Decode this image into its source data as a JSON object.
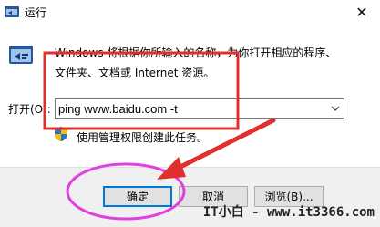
{
  "window": {
    "title": "运行",
    "close_glyph": "✕"
  },
  "description": {
    "line1": "Windows 将根据你所输入的名称，为你打开相应的程序、",
    "line2": "文件夹、文档或 Internet 资源。"
  },
  "open_field": {
    "label": "打开(O):",
    "value": "ping www.baidu.com -t"
  },
  "admin_note": "使用管理权限创建此任务。",
  "buttons": {
    "ok": "确定",
    "cancel": "取消",
    "browse": "浏览(B)..."
  },
  "watermark": "IT小白 - www.it3366.com",
  "colors": {
    "highlight_rect": "#e0302e",
    "highlight_ellipse": "#e040e0",
    "arrow": "#e0302e",
    "accent": "#0078d7"
  },
  "icons": {
    "title": "run-icon",
    "dialog": "run-dialog-icon",
    "shield": "uac-shield-icon",
    "combo": "chevron-down-icon"
  }
}
